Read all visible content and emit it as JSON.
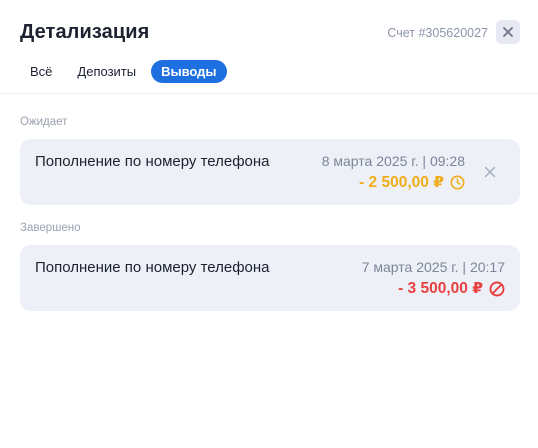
{
  "header": {
    "title": "Детализация",
    "account": "Счет #305620027"
  },
  "tabs": [
    {
      "label": "Всё",
      "active": false
    },
    {
      "label": "Депозиты",
      "active": false
    },
    {
      "label": "Выводы",
      "active": true
    }
  ],
  "sections": {
    "pending": {
      "label": "Ожидает",
      "item": {
        "title": "Пополнение по номеру телефона",
        "date": "8 марта 2025 г. | 09:28",
        "amount": "- 2 500,00 ₽",
        "status_icon": "clock-icon",
        "color": "#f0ad17"
      }
    },
    "completed": {
      "label": "Завершено",
      "item": {
        "title": "Пополнение по номеру телефона",
        "date": "7 марта 2025 г. | 20:17",
        "amount": "- 3 500,00 ₽",
        "status_icon": "blocked-icon",
        "color": "#e8403f"
      }
    }
  },
  "colors": {
    "accent": "#1e6fe0",
    "card_bg": "#edf0f7",
    "pending": "#f0ad17",
    "failed": "#e8403f"
  }
}
